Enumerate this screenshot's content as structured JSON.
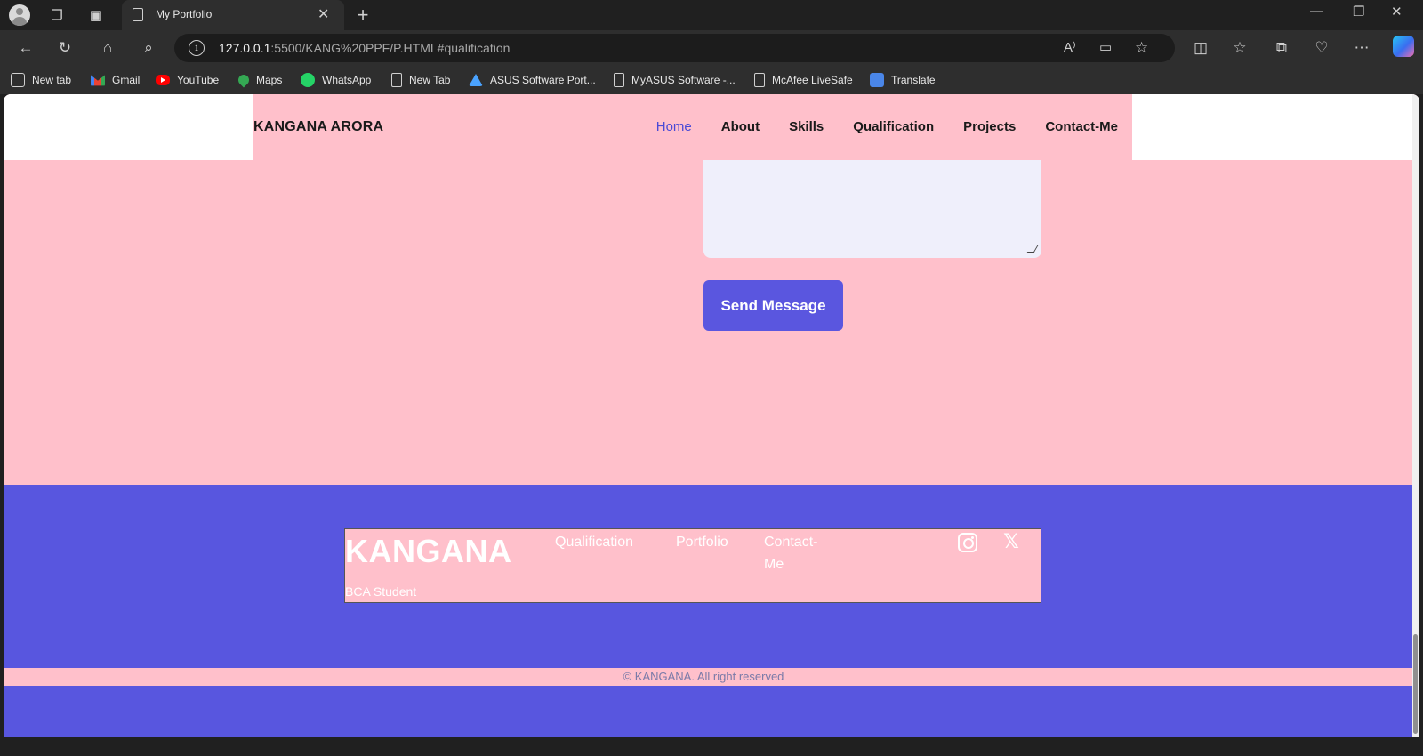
{
  "browser": {
    "tab_title": "My Portfolio",
    "url_host": "127.0.0.1",
    "url_rest": ":5500/KANG%20PPF/P.HTML#qualification",
    "bookmarks": [
      {
        "label": "New tab",
        "icon": "newtab-icon"
      },
      {
        "label": "Gmail",
        "icon": "gmail-icon"
      },
      {
        "label": "YouTube",
        "icon": "youtube-icon"
      },
      {
        "label": "Maps",
        "icon": "maps-icon"
      },
      {
        "label": "WhatsApp",
        "icon": "whatsapp-icon"
      },
      {
        "label": "New Tab",
        "icon": "document-icon"
      },
      {
        "label": "ASUS Software Port...",
        "icon": "asus-icon"
      },
      {
        "label": "MyASUS Software -...",
        "icon": "document-icon"
      },
      {
        "label": "McAfee LiveSafe",
        "icon": "document-icon"
      },
      {
        "label": "Translate",
        "icon": "translate-icon"
      }
    ]
  },
  "site": {
    "brand": "KANGANA ARORA",
    "nav": [
      {
        "label": "Home",
        "active": true
      },
      {
        "label": "About"
      },
      {
        "label": "Skills"
      },
      {
        "label": "Qualification"
      },
      {
        "label": "Projects"
      },
      {
        "label": "Contact-Me"
      }
    ],
    "send_button": "Send Message",
    "footer": {
      "title": "KANGANA",
      "subtitle": "BCA Student",
      "links": [
        "Qualification",
        "Portfolio",
        "Contact-",
        "Me"
      ],
      "social": [
        "instagram-icon",
        "x-icon"
      ],
      "copyright": "© KANGANA. All right reserved"
    }
  },
  "colors": {
    "page_bg": "#ffc0cb",
    "accent": "#5856df",
    "textarea_bg": "#efeffb"
  }
}
